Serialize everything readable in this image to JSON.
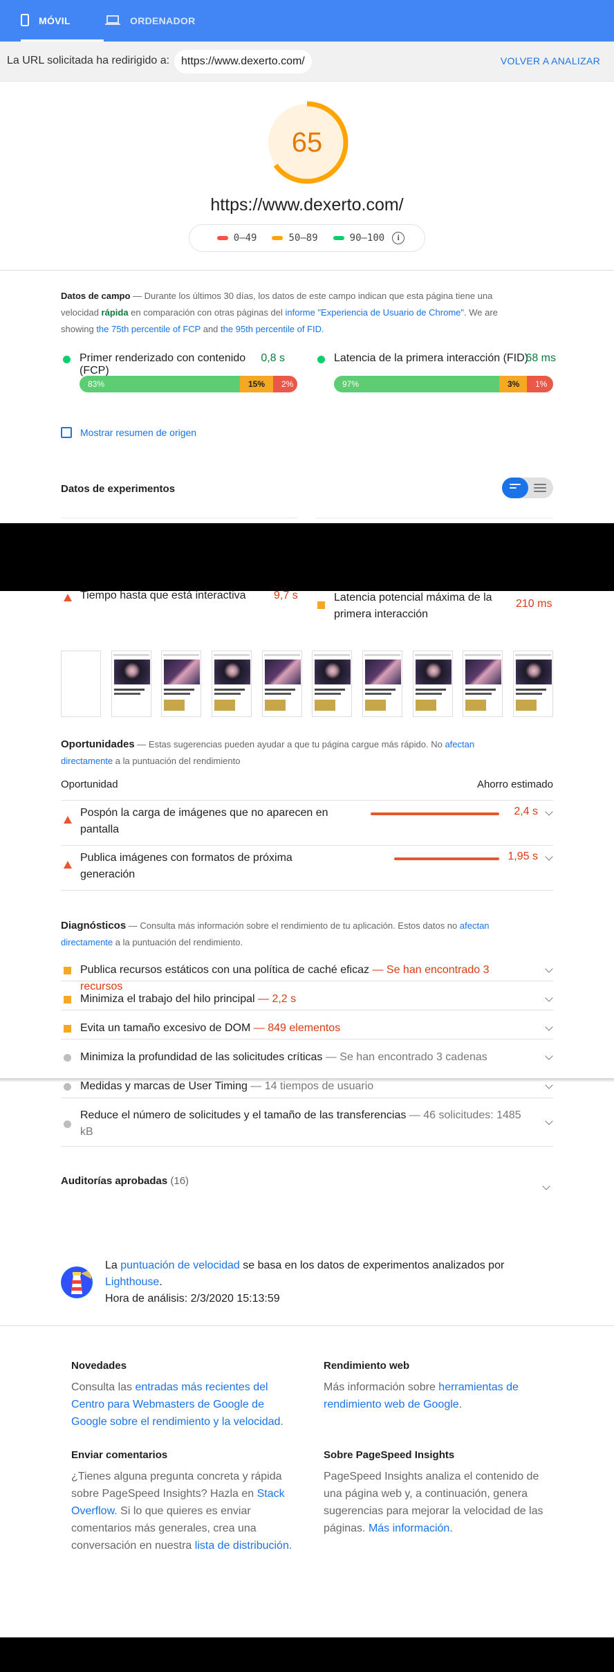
{
  "nav": {
    "tab_mobile": "MÓVIL",
    "tab_desktop": "ORDENADOR"
  },
  "urlbar": {
    "redirect_label": "La URL solicitada ha redirigido a:",
    "url": "https://www.dexerto.com/",
    "reanalyze": "VOLVER A ANALIZAR"
  },
  "score": {
    "value": "65",
    "fraction": 0.65,
    "url": "https://www.dexerto.com/",
    "legend": [
      "0–49",
      "50–89",
      "90–100"
    ],
    "colors": {
      "fail": "#ff4e42",
      "average": "#ffa400",
      "pass": "#0cce6b"
    }
  },
  "field": {
    "title": "Datos de campo",
    "desc_a": " — Durante los últimos 30 días, los datos de este campo indican que esta página tiene una velocidad ",
    "desc_fast": "rápida",
    "desc_b": " en comparación con otras páginas del ",
    "desc_link": "informe \"Experiencia de Usuario de Chrome\"",
    "desc_c": ". We are showing ",
    "desc_link2": "the 75th percentile of FCP",
    "desc_d": " and ",
    "desc_link3": "the 95th percentile of FID",
    "desc_e": ".",
    "fcp": {
      "label": "Primer renderizado con contenido (FCP)",
      "value": "0,8 s",
      "dist": [
        "83%",
        "15%",
        "2%"
      ]
    },
    "fid": {
      "label": "Latencia de la primera interacción (FID)",
      "value": "68 ms",
      "dist": [
        "97%",
        "3%",
        "1%"
      ]
    },
    "origin_summary": "Mostrar resumen de origen"
  },
  "lab": {
    "title": "Datos de experimentos",
    "tti": {
      "label": "Tiempo hasta que está interactiva",
      "value": "9,7 s"
    },
    "max_fid": {
      "label": "Latencia potencial máxima de la primera interacción",
      "value": "210 ms"
    }
  },
  "opportunities": {
    "title": "Oportunidades",
    "desc_a": " — Estas sugerencias pueden ayudar a que tu página cargue más rápido. No ",
    "desc_link": "afectan directamente",
    "desc_b": " a la puntuación del rendimiento",
    "col_left": "Oportunidad",
    "col_right": "Ahorro estimado",
    "items": [
      {
        "label": "Pospón la carga de imágenes que no aparecen en pantalla",
        "value": "2,4 s",
        "savings_s": 2.4
      },
      {
        "label": "Publica imágenes con formatos de próxima generación",
        "value": "1,95 s",
        "savings_s": 1.95
      }
    ]
  },
  "diagnostics": {
    "title": "Diagnósticos",
    "desc_a": " — Consulta más información sobre el rendimiento de tu aplicación. Estos datos no ",
    "desc_link": "afectan directamente",
    "desc_b": " a la puntuación del rendimiento.",
    "items": [
      {
        "label": "Publica recursos estáticos con una política de caché eficaz",
        "sub": " — Se han encontrado 3 recursos"
      },
      {
        "label": "Minimiza el trabajo del hilo principal",
        "sub": " — 2,2 s"
      },
      {
        "label": "Evita un tamaño excesivo de DOM",
        "sub": " — 849 elementos"
      },
      {
        "label": "Minimiza la profundidad de las solicitudes críticas",
        "sub": " — Se han encontrado 3 cadenas"
      },
      {
        "label": "Medidas y marcas de User Timing",
        "sub": " — 14 tiempos de usuario"
      },
      {
        "label": "Reduce el número de solicitudes y el tamaño de las transferencias",
        "sub": " — 46 solicitudes: 1485 kB"
      }
    ]
  },
  "passed": {
    "label": "Auditorías aprobadas",
    "count": "(16)"
  },
  "lighthouse": {
    "a": "La ",
    "link1": "puntuación de velocidad",
    "b": " se basa en los datos de experimentos analizados por ",
    "link2": "Lighthouse",
    "c": ".",
    "time": "Hora de análisis: 2/3/2020 15:13:59"
  },
  "footer": {
    "news": {
      "title": "Novedades",
      "a": "Consulta las ",
      "link": "entradas más recientes del Centro para Webmasters de Google de Google sobre el rendimiento y la velocidad",
      "b": "."
    },
    "web": {
      "title": "Rendimiento web",
      "a": "Más información sobre ",
      "link": "herramientas de rendimiento web de Google",
      "b": "."
    },
    "feedback": {
      "title": "Enviar comentarios",
      "a": "¿Tienes alguna pregunta concreta y rápida sobre PageSpeed Insights? Hazla en ",
      "link": "Stack Overflow",
      "b": ". Si lo que quieres es enviar comentarios más generales, crea una conversación en nuestra ",
      "link2": "lista de distribución",
      "c": "."
    },
    "about": {
      "title": "Sobre PageSpeed Insights",
      "a": "PageSpeed Insights analiza el contenido de una página web y, a continuación, genera sugerencias para mejorar la velocidad de las páginas. ",
      "link": "Más información",
      "b": "."
    }
  }
}
